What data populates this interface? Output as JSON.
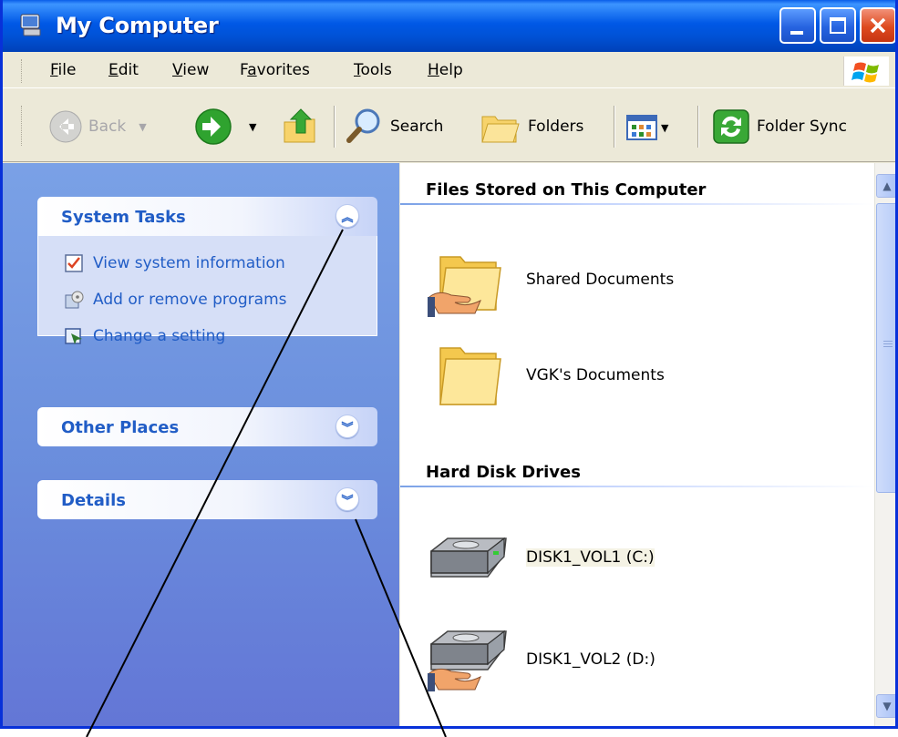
{
  "window": {
    "title": "My Computer"
  },
  "menu": {
    "items": [
      "File",
      "Edit",
      "View",
      "Favorites",
      "Tools",
      "Help"
    ],
    "underline": [
      "F",
      "E",
      "V",
      "a",
      "T",
      "H"
    ]
  },
  "toolbar": {
    "back_label": "Back",
    "search_label": "Search",
    "folders_label": "Folders",
    "sync_label": "Folder Sync"
  },
  "left_pane": {
    "system_tasks": {
      "title": "System Tasks",
      "items": [
        "View system information",
        "Add or remove programs",
        "Change a setting"
      ]
    },
    "other_places": {
      "title": "Other Places"
    },
    "details": {
      "title": "Details"
    }
  },
  "right_pane": {
    "group1": {
      "title": "Files Stored on This Computer",
      "items": [
        "Shared Documents",
        "VGK's Documents"
      ]
    },
    "group2": {
      "title": "Hard Disk Drives",
      "items": [
        "DISK1_VOL1 (C:)",
        "DISK1_VOL2 (D:)"
      ]
    }
  },
  "colors": {
    "titlebar": "#0058e6",
    "task_pane": "#6b8fdd",
    "link": "#215dc6",
    "close_button": "#de4a1f"
  }
}
